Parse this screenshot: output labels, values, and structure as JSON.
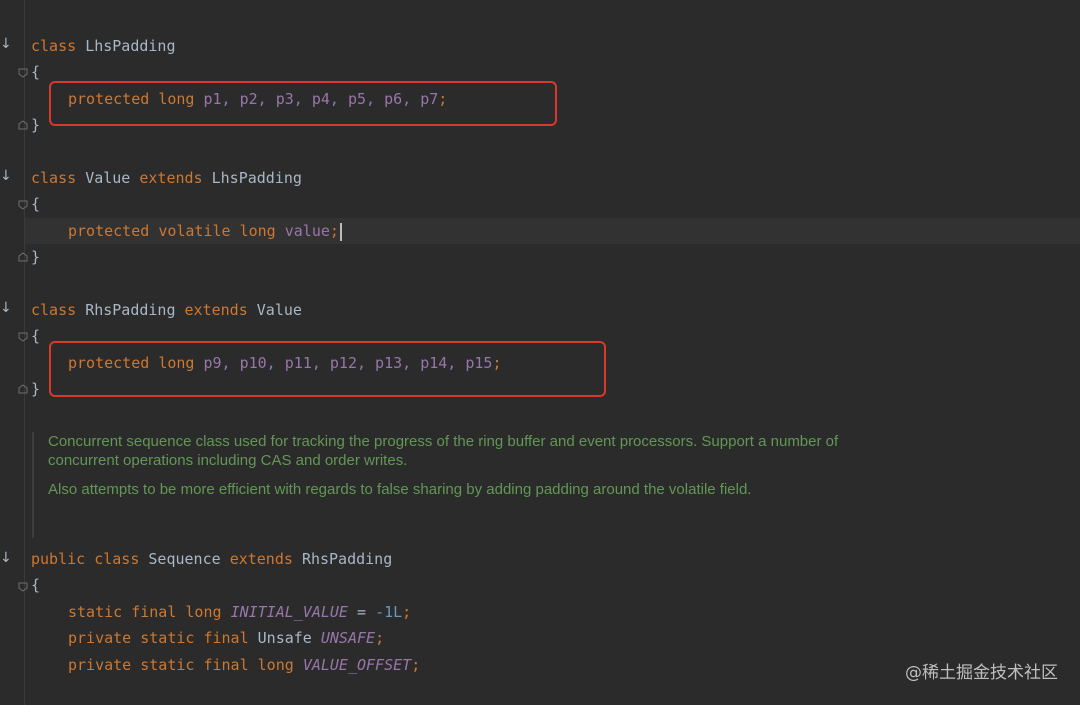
{
  "code": {
    "lhs": {
      "decl": {
        "class_kw": "class",
        "name": "LhsPadding"
      },
      "open": "{",
      "field": {
        "mod": "protected",
        "type": "long",
        "vars": "p1, p2, p3, p4, p5, p6, p7",
        "semi": ";"
      },
      "close": "}"
    },
    "value": {
      "decl": {
        "class_kw": "class",
        "name": "Value",
        "extends_kw": "extends",
        "parent": "LhsPadding"
      },
      "open": "{",
      "field": {
        "mod": "protected",
        "mod2": "volatile",
        "type": "long",
        "var": "value",
        "semi": ";"
      },
      "close": "}"
    },
    "rhs": {
      "decl": {
        "class_kw": "class",
        "name": "RhsPadding",
        "extends_kw": "extends",
        "parent": "Value"
      },
      "open": "{",
      "field": {
        "mod": "protected",
        "type": "long",
        "vars": "p9, p10, p11, p12, p13, p14, p15",
        "semi": ";"
      },
      "close": "}"
    },
    "doc": {
      "p1": "Concurrent sequence class used for tracking the progress of the ring buffer and event processors. Support a number of concurrent operations including CAS and order writes.",
      "p2": "Also attempts to be more efficient with regards to false sharing by adding padding around the volatile field."
    },
    "sequence": {
      "decl": {
        "pub_kw": "public",
        "class_kw": "class",
        "name": "Sequence",
        "extends_kw": "extends",
        "parent": "RhsPadding"
      },
      "open": "{",
      "l1": {
        "mods": "static final long",
        "name": "INITIAL_VALUE",
        "eq": " = ",
        "val": "-1L",
        "semi": ";"
      },
      "l2": {
        "mods": "private static final",
        "type": "Unsafe",
        "name": "UNSAFE",
        "semi": ";"
      },
      "l3": {
        "mods": "private static final long",
        "name": "VALUE_OFFSET",
        "semi": ";"
      }
    }
  },
  "watermark": "@稀土掘金技术社区"
}
